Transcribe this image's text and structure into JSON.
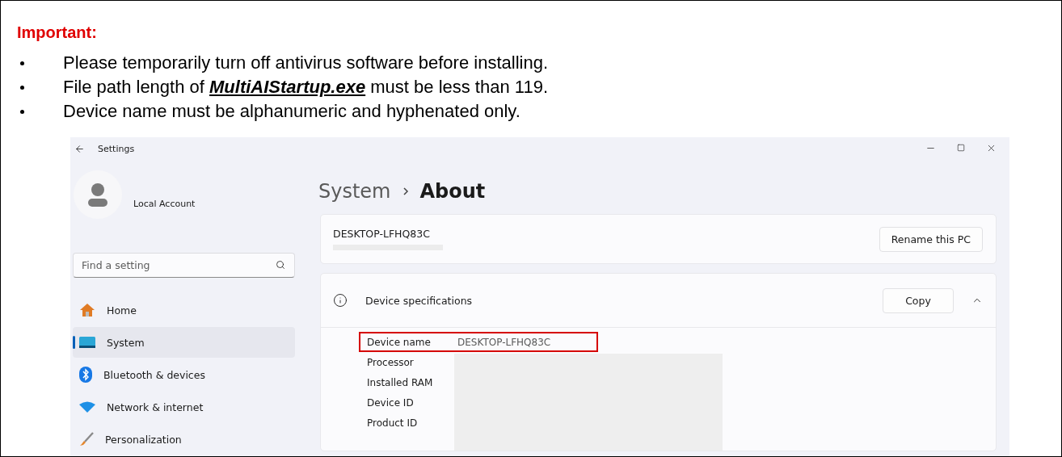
{
  "notice": {
    "heading": "Important:",
    "bullets": [
      "Please temporarily turn off antivirus software before installing.",
      "File path length of **MultiAIStartup.exe** must be less than 119.",
      "Device name must be alphanumeric and hyphenated only."
    ]
  },
  "settings": {
    "title": "Settings",
    "account": {
      "label": "Local Account"
    },
    "search": {
      "placeholder": "Find a setting"
    },
    "nav": [
      {
        "label": "Home",
        "kind": "home",
        "selected": false
      },
      {
        "label": "System",
        "kind": "system",
        "selected": true
      },
      {
        "label": "Bluetooth & devices",
        "kind": "bluetooth",
        "selected": false
      },
      {
        "label": "Network & internet",
        "kind": "network",
        "selected": false
      },
      {
        "label": "Personalization",
        "kind": "personalization",
        "selected": false
      }
    ],
    "breadcrumb": {
      "parent": "System",
      "current": "About"
    },
    "pc": {
      "name": "DESKTOP-LFHQ83C",
      "button": "Rename this PC"
    },
    "specs": {
      "title": "Device specifications",
      "button": "Copy",
      "expanded": true,
      "rows": [
        {
          "label": "Device name",
          "value": "DESKTOP-LFHQ83C",
          "highlighted": true
        },
        {
          "label": "Processor",
          "highlighted": false
        },
        {
          "label": "Installed RAM",
          "highlighted": false
        },
        {
          "label": "Device ID",
          "highlighted": false
        },
        {
          "label": "Product ID",
          "highlighted": false
        }
      ]
    }
  }
}
